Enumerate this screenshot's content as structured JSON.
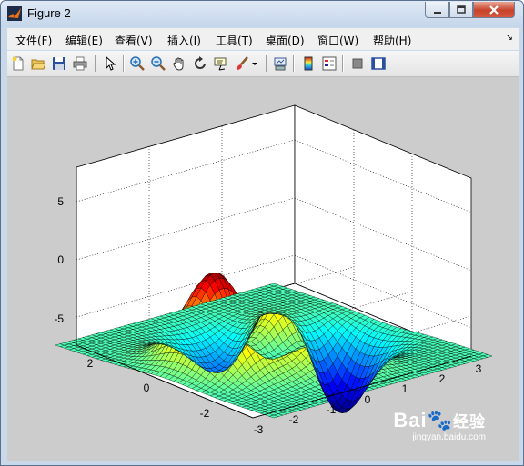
{
  "window": {
    "title": "Figure 2"
  },
  "menu": [
    "文件(F)",
    "编辑(E)",
    "查看(V)",
    "插入(I)",
    "工具(T)",
    "桌面(D)",
    "窗口(W)",
    "帮助(H)"
  ],
  "toolbar_icons": [
    "new-figure-icon",
    "open-file-icon",
    "save-icon",
    "print-icon",
    "edit-plot-icon",
    "zoom-in-icon",
    "zoom-out-icon",
    "pan-icon",
    "rotate-3d-icon",
    "data-cursor-icon",
    "brush-icon",
    "link-plot-icon",
    "colorbar-icon",
    "legend-icon",
    "hide-plot-tools-icon",
    "show-plot-tools-icon"
  ],
  "axes": {
    "z_ticks": [
      "5",
      "0",
      "-5"
    ],
    "y_ticks": [
      "2",
      "0",
      "-2"
    ],
    "x_ticks": [
      "-3",
      "-2",
      "-1",
      "0",
      "1",
      "2",
      "3"
    ]
  },
  "colors": {
    "background": "#cccccc",
    "surface_colormap": "jet"
  },
  "watermark": {
    "brand": "Bai",
    "brand2": "经验",
    "url": "jingyan.baidu.com"
  }
}
